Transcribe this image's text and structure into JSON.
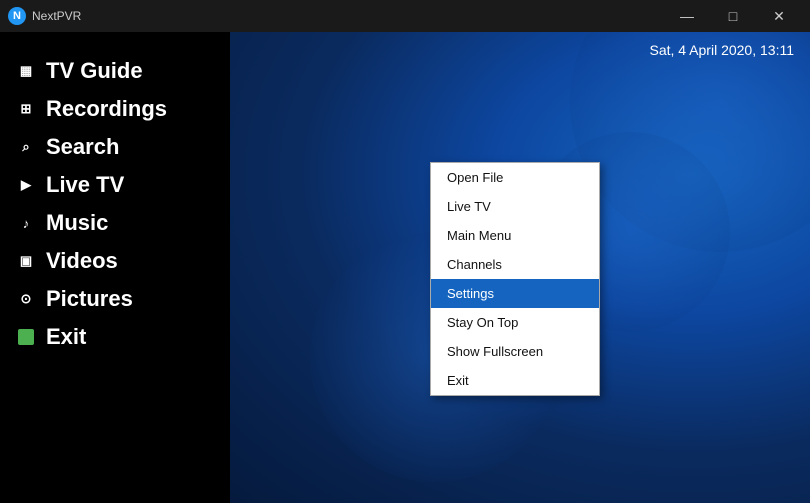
{
  "titlebar": {
    "app_name": "NextPVR",
    "icon_text": "N",
    "controls": {
      "minimize": "—",
      "maximize": "□",
      "close": "✕"
    }
  },
  "datetime": "Sat, 4 April 2020, 13:11",
  "sidebar": {
    "items": [
      {
        "id": "tv-guide",
        "label": "TV Guide",
        "icon": "▦"
      },
      {
        "id": "recordings",
        "label": "Recordings",
        "icon": "⊞"
      },
      {
        "id": "search",
        "label": "Search",
        "icon": "🔍"
      },
      {
        "id": "live-tv",
        "label": "Live TV",
        "icon": "▶"
      },
      {
        "id": "music",
        "label": "Music",
        "icon": "♪"
      },
      {
        "id": "videos",
        "label": "Videos",
        "icon": "▣"
      },
      {
        "id": "pictures",
        "label": "Pictures",
        "icon": "⊙"
      },
      {
        "id": "exit",
        "label": "Exit",
        "icon": "E",
        "active": true
      }
    ]
  },
  "context_menu": {
    "items": [
      {
        "id": "open-file",
        "label": "Open File",
        "highlighted": false
      },
      {
        "id": "live-tv",
        "label": "Live TV",
        "highlighted": false
      },
      {
        "id": "main-menu",
        "label": "Main Menu",
        "highlighted": false
      },
      {
        "id": "channels",
        "label": "Channels",
        "highlighted": false
      },
      {
        "id": "settings",
        "label": "Settings",
        "highlighted": true
      },
      {
        "id": "stay-on-top",
        "label": "Stay On Top",
        "highlighted": false
      },
      {
        "id": "show-fullscreen",
        "label": "Show Fullscreen",
        "highlighted": false
      },
      {
        "id": "exit",
        "label": "Exit",
        "highlighted": false
      }
    ]
  }
}
